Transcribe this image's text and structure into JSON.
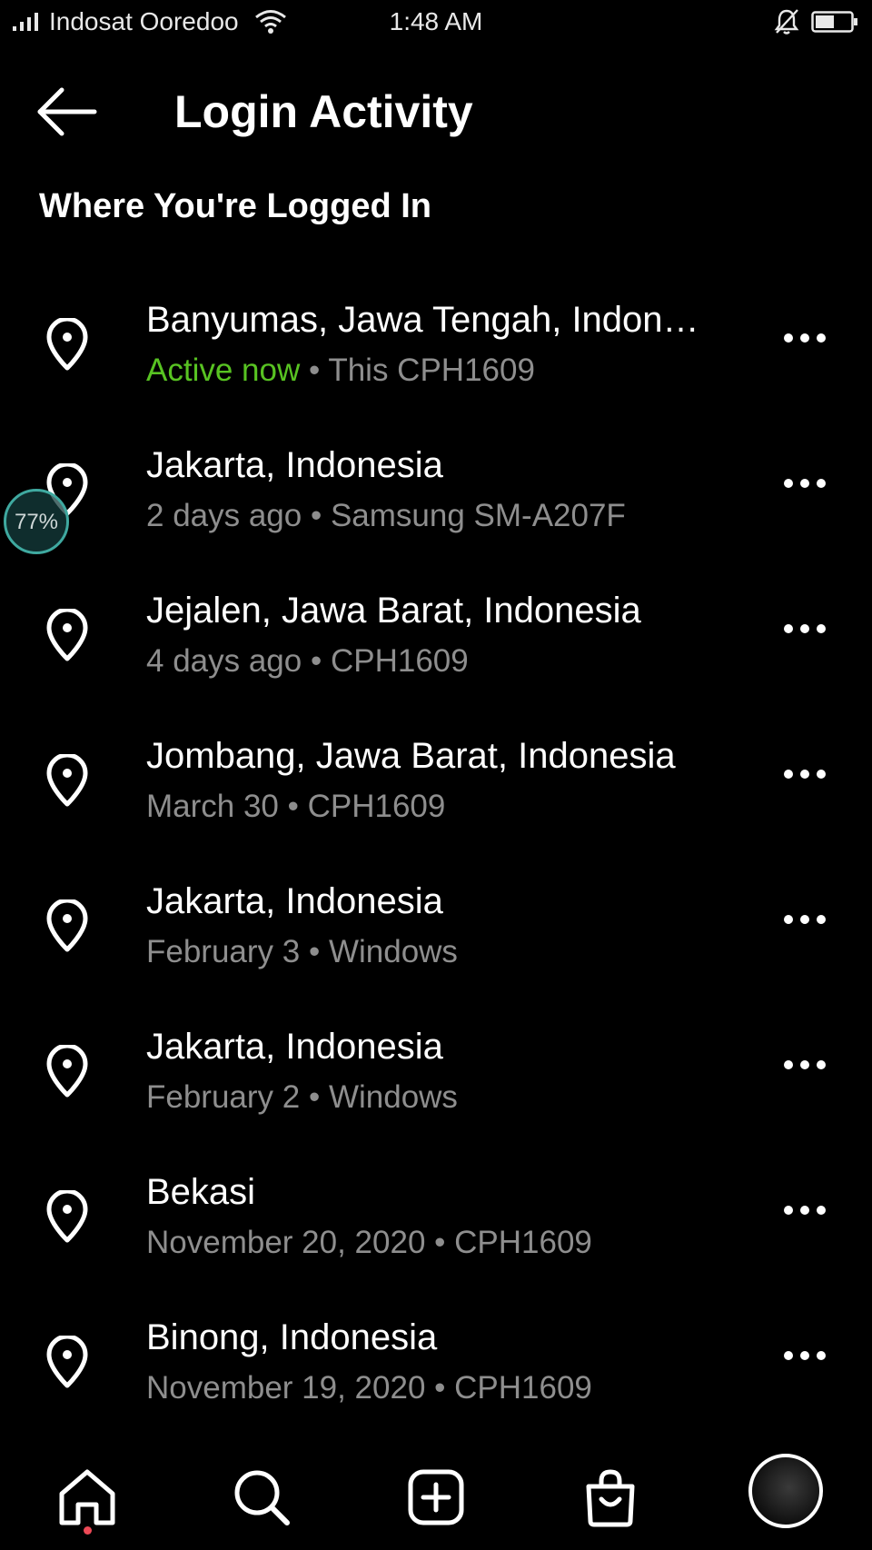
{
  "status_bar": {
    "carrier": "Indosat Ooredoo",
    "time": "1:48 AM"
  },
  "header": {
    "title": "Login Activity"
  },
  "section_title": "Where You're Logged In",
  "sessions": [
    {
      "location": "Banyumas, Jawa Tengah, Indonesia",
      "status": "Active now",
      "separator": " • ",
      "device": "This CPH1609"
    },
    {
      "location": "Jakarta, Indonesia",
      "status": "2 days ago",
      "separator": " • ",
      "device": "Samsung SM-A207F"
    },
    {
      "location": "Jejalen, Jawa Barat, Indonesia",
      "status": "4 days ago",
      "separator": " • ",
      "device": "CPH1609"
    },
    {
      "location": "Jombang, Jawa Barat, Indonesia",
      "status": "March 30",
      "separator": " • ",
      "device": "CPH1609"
    },
    {
      "location": "Jakarta, Indonesia",
      "status": "February 3",
      "separator": " • ",
      "device": "Windows"
    },
    {
      "location": "Jakarta, Indonesia",
      "status": "February 2",
      "separator": " • ",
      "device": "Windows"
    },
    {
      "location": "Bekasi",
      "status": "November 20, 2020",
      "separator": " • ",
      "device": "CPH1609"
    },
    {
      "location": "Binong, Indonesia",
      "status": "November 19, 2020",
      "separator": " • ",
      "device": "CPH1609"
    }
  ],
  "float_widget": {
    "text": "77%"
  },
  "colors": {
    "background": "#000000",
    "active_status": "#58c322",
    "secondary_text": "#8e8e8e",
    "notification_dot": "#ed4956"
  },
  "icons": {
    "back": "arrow-left-icon",
    "session": "location-pin-icon",
    "more": "more-horizontal-icon",
    "nav": [
      "home-icon",
      "search-icon",
      "create-post-icon",
      "shop-bag-icon",
      "profile-avatar"
    ]
  }
}
